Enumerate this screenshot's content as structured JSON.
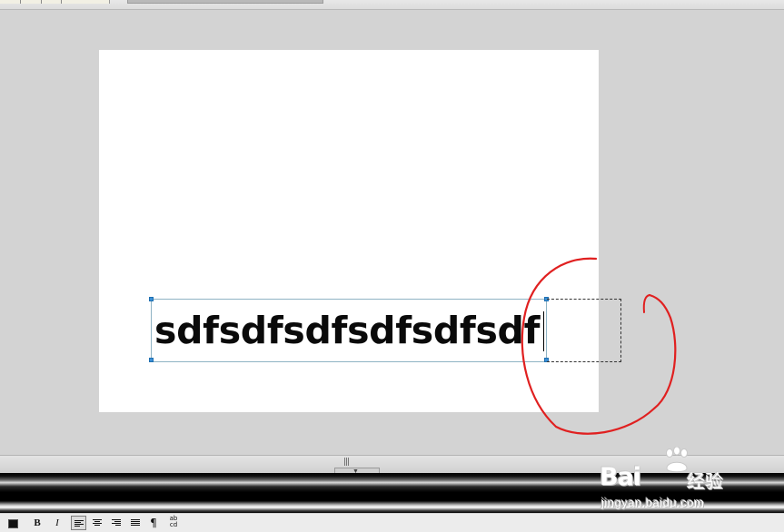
{
  "slide": {
    "textbox_text": "sdfsdfsdfsdfsdfsdf"
  },
  "icons": {
    "font_color": "font-color-icon",
    "bold": "bold-icon",
    "italic": "italic-icon",
    "align_left": "align-left-icon",
    "align_center": "align-center-icon",
    "align_right": "align-right-icon",
    "align_justify": "align-justify-icon",
    "paragraph": "pilcrow-icon",
    "spelling": "spelling-check-icon"
  },
  "toolbar": {
    "bold_label": "B",
    "italic_label": "I",
    "paragraph_label": "¶",
    "spelling_label": "ab cd"
  },
  "splitter": {
    "grip": "|||",
    "collapse_glyph": "▼"
  },
  "watermark": {
    "brand": "Bai",
    "suffix": "经验",
    "url": "jingyan.baidu.com"
  },
  "colors": {
    "annotation": "#e02020",
    "selection_handle": "#3a8fd6",
    "canvas": "#d3d3d3",
    "slide": "#ffffff"
  }
}
